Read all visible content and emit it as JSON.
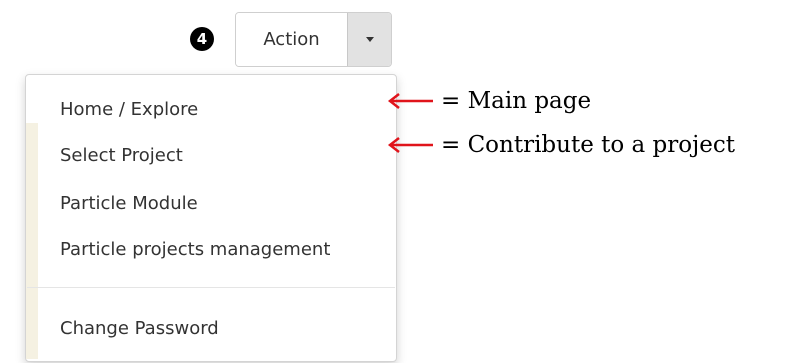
{
  "step_badge": "4",
  "action_button": {
    "label": "Action"
  },
  "dropdown": {
    "items": [
      {
        "label": "Home / Explore"
      },
      {
        "label": "Select Project"
      },
      {
        "label": "Particle Module"
      },
      {
        "label": "Particle projects management"
      },
      {
        "label": "Change Password"
      }
    ]
  },
  "annotations": [
    {
      "text": "= Main page"
    },
    {
      "text": "= Contribute to a project"
    }
  ],
  "colors": {
    "arrow": "#e0141b",
    "caret_bg": "#e2e2e2",
    "menu_text": "#333333"
  }
}
